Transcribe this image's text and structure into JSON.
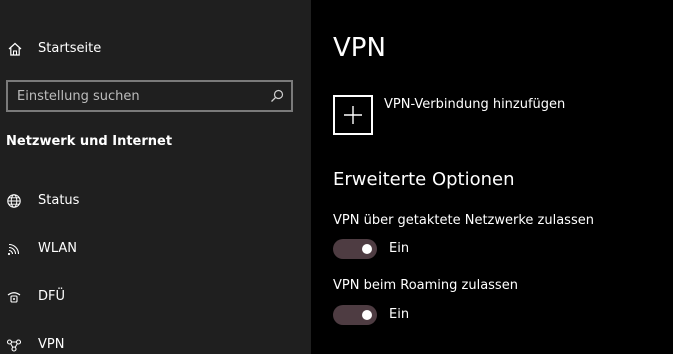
{
  "sidebar": {
    "home": {
      "label": "Startseite",
      "icon": "home-icon"
    },
    "search": {
      "placeholder": "Einstellung suchen",
      "value": "",
      "icon": "search-icon"
    },
    "section_title": "Netzwerk und Internet",
    "items": [
      {
        "label": "Status",
        "icon": "globe-icon"
      },
      {
        "label": "WLAN",
        "icon": "wifi-icon"
      },
      {
        "label": "DFÜ",
        "icon": "dialup-icon"
      },
      {
        "label": "VPN",
        "icon": "vpn-icon"
      }
    ]
  },
  "main": {
    "title": "VPN",
    "add_connection_label": "VPN-Verbindung hinzufügen",
    "advanced_heading": "Erweiterte Optionen",
    "options": [
      {
        "label": "VPN über getaktete Netzwerke zulassen",
        "state": "Ein",
        "on": true
      },
      {
        "label": "VPN beim Roaming zulassen",
        "state": "Ein",
        "on": true
      }
    ]
  },
  "colors": {
    "sidebar_bg": "#1f1f1f",
    "main_bg": "#000000",
    "toggle_on_bg": "#4e3c42",
    "search_border": "#7a7a7a"
  }
}
